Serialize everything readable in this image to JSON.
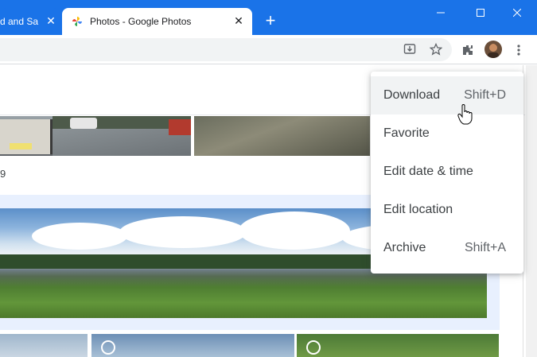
{
  "browser": {
    "tabs": [
      {
        "title": "d and Sa",
        "active": false
      },
      {
        "title": "Photos - Google Photos",
        "active": true
      }
    ],
    "colors": {
      "titlebar": "#1a73e8",
      "active_tab": "#ffffff"
    }
  },
  "toolbar": {
    "icons": [
      "install-icon",
      "star-icon",
      "extensions-icon",
      "profile-avatar",
      "menu-icon"
    ]
  },
  "content": {
    "date_label": "9"
  },
  "context_menu": {
    "items": [
      {
        "label": "Download",
        "shortcut": "Shift+D",
        "hovered": true
      },
      {
        "label": "Favorite",
        "shortcut": ""
      },
      {
        "label": "Edit date & time",
        "shortcut": ""
      },
      {
        "label": "Edit location",
        "shortcut": ""
      },
      {
        "label": "Archive",
        "shortcut": "Shift+A"
      }
    ]
  }
}
